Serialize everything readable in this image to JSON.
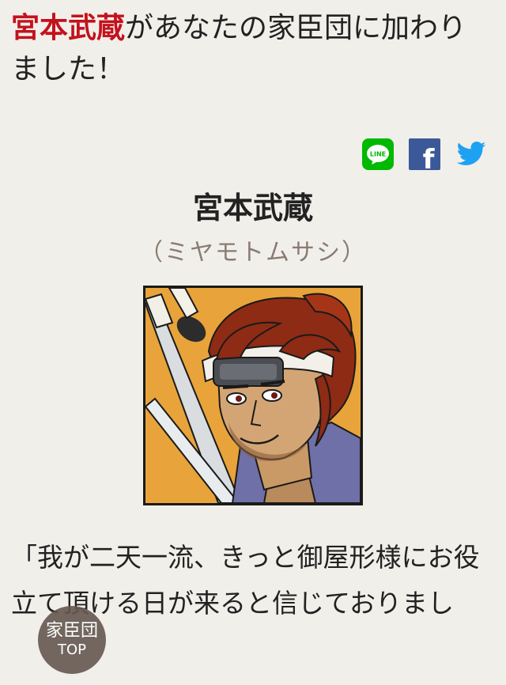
{
  "headline": {
    "name": "宮本武蔵",
    "rest": "があなたの家臣団に加わりました！"
  },
  "share": {
    "line_label": "LINE",
    "facebook_label": "f"
  },
  "character": {
    "name": "宮本武蔵",
    "reading": "（ミヤモトムサシ）"
  },
  "quote": "「我が二天一流、きっと御屋形様にお役立て頂ける日が来ると信じておりまし",
  "top_button": {
    "line1": "家臣団",
    "line2": "TOP"
  },
  "colors": {
    "accent_red": "#c3121d",
    "line_green": "#00b900",
    "facebook_blue": "#3b5998",
    "twitter_blue": "#1da1f2",
    "background": "#f1efea",
    "portrait_bg": "#e8a43a"
  }
}
